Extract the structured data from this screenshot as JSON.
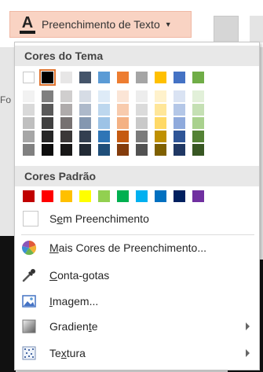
{
  "ribbon": {
    "button_label": "Preenchimento de Texto",
    "left_fragment": "Fo"
  },
  "menu": {
    "theme_header": "Cores do Tema",
    "standard_header": "Cores Padrão",
    "no_fill": "Sem Preenchimento",
    "no_fill_parts": [
      "S",
      "e",
      "m Preenchimento"
    ],
    "more_colors": "Mais Cores de Preenchimento...",
    "more_colors_parts": [
      "",
      "M",
      "ais Cores de Preenchimento..."
    ],
    "eyedropper": "Conta-gotas",
    "eyedropper_parts": [
      "",
      "C",
      "onta-gotas"
    ],
    "image": "Imagem...",
    "image_parts": [
      "",
      "I",
      "magem..."
    ],
    "gradient": "Gradiente",
    "gradient_parts": [
      "Gradien",
      "t",
      "e"
    ],
    "texture": "Textura",
    "texture_parts": [
      "Te",
      "x",
      "tura"
    ]
  },
  "theme_colors": [
    {
      "base": "#ffffff",
      "shades": [
        "#f2f2f2",
        "#d9d9d9",
        "#bfbfbf",
        "#a6a6a6",
        "#808080"
      ]
    },
    {
      "base": "#000000",
      "shades": [
        "#7f7f7f",
        "#595959",
        "#404040",
        "#262626",
        "#0d0d0d"
      ]
    },
    {
      "base": "#e7e6e6",
      "shades": [
        "#d0cece",
        "#afabab",
        "#767171",
        "#3b3838",
        "#181717"
      ]
    },
    {
      "base": "#44546a",
      "shades": [
        "#d6dce5",
        "#adb9ca",
        "#8497b0",
        "#333f50",
        "#222a35"
      ]
    },
    {
      "base": "#5b9bd5",
      "shades": [
        "#deebf7",
        "#bdd7ee",
        "#9dc3e6",
        "#2e75b6",
        "#1f4e79"
      ]
    },
    {
      "base": "#ed7d31",
      "shades": [
        "#fbe5d6",
        "#f8cbad",
        "#f4b183",
        "#c55a11",
        "#843c0c"
      ]
    },
    {
      "base": "#a5a5a5",
      "shades": [
        "#ededed",
        "#dbdbdb",
        "#c9c9c9",
        "#7b7b7b",
        "#525252"
      ]
    },
    {
      "base": "#ffc000",
      "shades": [
        "#fff2cc",
        "#ffe699",
        "#ffd966",
        "#bf9000",
        "#7f6000"
      ]
    },
    {
      "base": "#4472c4",
      "shades": [
        "#dae3f3",
        "#b4c7e7",
        "#8faadc",
        "#2f5597",
        "#203864"
      ]
    },
    {
      "base": "#70ad47",
      "shades": [
        "#e2f0d9",
        "#c5e0b4",
        "#a9d18e",
        "#548235",
        "#385723"
      ]
    }
  ],
  "standard_colors": [
    "#c00000",
    "#ff0000",
    "#ffc000",
    "#ffff00",
    "#92d050",
    "#00b050",
    "#00b0f0",
    "#0070c0",
    "#002060",
    "#7030a0"
  ],
  "icons": {
    "more_colors": "color-wheel-icon",
    "eyedropper": "eyedropper-icon",
    "image": "picture-icon",
    "gradient": "gradient-icon",
    "texture": "texture-icon",
    "text_fill": "text-fill-a-icon"
  },
  "accent_color": "#e0742f"
}
